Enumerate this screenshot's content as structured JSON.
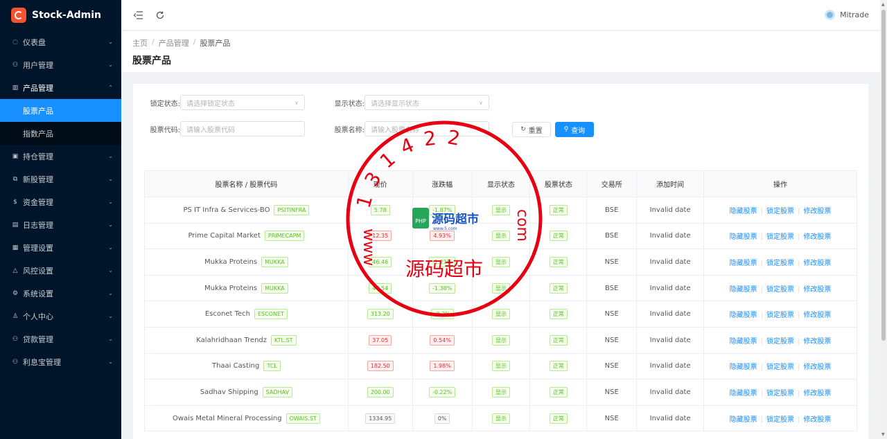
{
  "app": {
    "title": "Stock-Admin",
    "colors": {
      "sidebar": "#001529",
      "accent": "#1890ff",
      "stamp": "#e60012"
    }
  },
  "header": {
    "user_name": "Mitrade"
  },
  "sidebar": {
    "items": [
      {
        "label": "仪表盘",
        "icon": "dashboard-icon",
        "glyph": "◌"
      },
      {
        "label": "用户管理",
        "icon": "users-icon",
        "glyph": "⚇"
      },
      {
        "label": "产品管理",
        "icon": "chart-icon",
        "glyph": "▥",
        "open": true,
        "children": [
          {
            "label": "股票产品",
            "active": true
          },
          {
            "label": "指数产品"
          }
        ]
      },
      {
        "label": "持仓管理",
        "icon": "position-icon",
        "glyph": "▣"
      },
      {
        "label": "新股管理",
        "icon": "ipo-icon",
        "glyph": "⧉"
      },
      {
        "label": "资金管理",
        "icon": "money-icon",
        "glyph": "$"
      },
      {
        "label": "日志管理",
        "icon": "log-icon",
        "glyph": "▤"
      },
      {
        "label": "管理设置",
        "icon": "admin-icon",
        "glyph": "▦"
      },
      {
        "label": "风控设置",
        "icon": "risk-icon",
        "glyph": "△"
      },
      {
        "label": "系统设置",
        "icon": "settings-icon",
        "glyph": "⚙"
      },
      {
        "label": "个人中心",
        "icon": "user-icon",
        "glyph": "♙"
      },
      {
        "label": "贷款管理",
        "icon": "loan-icon",
        "glyph": "⚇"
      },
      {
        "label": "利息宝管理",
        "icon": "interest-icon",
        "glyph": "⚇"
      }
    ]
  },
  "breadcrumb": {
    "home": "主页",
    "parent": "产品管理",
    "current": "股票产品"
  },
  "page_title": "股票产品",
  "filters": {
    "lock_label": "锁定状态:",
    "lock_placeholder": "请选择锁定状态",
    "show_label": "显示状态:",
    "show_placeholder": "请选择显示状态",
    "code_label": "股票代码:",
    "code_placeholder": "请输入股票代码",
    "name_label": "股票名称:",
    "name_placeholder": "请输入股票名称",
    "reset_label": "重置",
    "query_label": "查询"
  },
  "table": {
    "columns": [
      "股票名称 / 股票代码",
      "现价",
      "涨跌幅",
      "显示状态",
      "股票状态",
      "交易所",
      "添加时间",
      "操作"
    ],
    "rows": [
      {
        "name": "PS IT Infra & Services-BO",
        "code": "PSITINFRA",
        "price": "5.78",
        "price_color": "green",
        "change": "-1.87%",
        "change_color": "green",
        "show": "显示",
        "status": "正常",
        "exchange": "BSE",
        "time": "Invalid date"
      },
      {
        "name": "Prime Capital Market",
        "code": "PRIMECAPM",
        "price": "12.35",
        "price_color": "red",
        "change": "4.93%",
        "change_color": "red",
        "show": "显示",
        "status": "正常",
        "exchange": "BSE",
        "time": "Invalid date"
      },
      {
        "name": "Mukka Proteins",
        "code": "MUKKA",
        "price": "46.46",
        "price_color": "green",
        "change": "-1.21%",
        "change_color": "green",
        "show": "显示",
        "status": "正常",
        "exchange": "NSE",
        "time": "Invalid date"
      },
      {
        "name": "Mukka Proteins",
        "code": "MUKKA",
        "price": "46.54",
        "price_color": "green",
        "change": "-1.38%",
        "change_color": "green",
        "show": "显示",
        "status": "正常",
        "exchange": "BSE",
        "time": "Invalid date"
      },
      {
        "name": "Esconet Tech",
        "code": "ESCONET",
        "price": "313.20",
        "price_color": "green",
        "change": "-0.2%",
        "change_color": "green",
        "show": "显示",
        "status": "正常",
        "exchange": "NSE",
        "time": "Invalid date"
      },
      {
        "name": "Kalahridhaan Trendz",
        "code": "KTL.ST",
        "price": "37.05",
        "price_color": "red",
        "change": "0.54%",
        "change_color": "red",
        "show": "显示",
        "status": "正常",
        "exchange": "NSE",
        "time": "Invalid date"
      },
      {
        "name": "Thaai Casting",
        "code": "TCL",
        "price": "182.50",
        "price_color": "red",
        "change": "1.98%",
        "change_color": "red",
        "show": "显示",
        "status": "正常",
        "exchange": "NSE",
        "time": "Invalid date"
      },
      {
        "name": "Sadhav Shipping",
        "code": "SADHAV",
        "price": "200.00",
        "price_color": "green",
        "change": "-0.22%",
        "change_color": "green",
        "show": "显示",
        "status": "正常",
        "exchange": "NSE",
        "time": "Invalid date"
      },
      {
        "name": "Owais Metal Mineral Processing",
        "code": "OWAIS.ST",
        "price": "1334.95",
        "price_color": "gray",
        "change": "0%",
        "change_color": "gray",
        "show": "显示",
        "status": "正常",
        "exchange": "NSE",
        "time": "Invalid date"
      }
    ],
    "actions": [
      "隐藏股票",
      "锁定股票",
      "修改股票"
    ]
  },
  "watermark": {
    "number_text": "131422",
    "www_text": "www",
    "com_text": "com",
    "name_text": "源码超市",
    "logo_text": "源码超市",
    "logo_badge": "PHP",
    "logo_url": "www.5.com"
  }
}
